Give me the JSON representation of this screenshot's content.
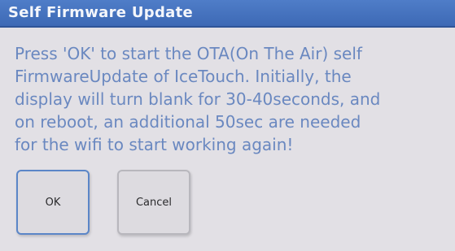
{
  "dialog": {
    "title": "Self Firmware Update",
    "message_lines": [
      "Press 'OK' to start the OTA(On The Air) self",
      "FirmwareUpdate of IceTouch. Initially, the",
      "display will turn blank for 30-40seconds, and",
      "on reboot, an additional 50sec are needed",
      "for the wifi to start working again!"
    ],
    "buttons": {
      "ok_label": "OK",
      "cancel_label": "Cancel"
    }
  },
  "colors": {
    "title_bar": "#4677c2",
    "message_text": "#6a88c0",
    "background": "#e2e0e5",
    "focus_border": "#5b86c8"
  }
}
